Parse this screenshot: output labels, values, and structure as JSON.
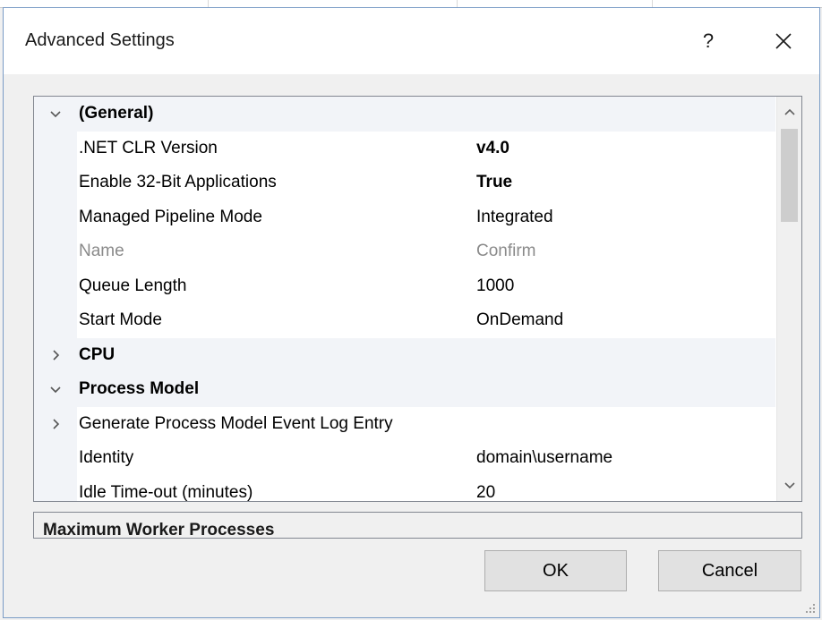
{
  "dialog": {
    "title": "Advanced Settings",
    "help_label": "?",
    "close_icon": "close-icon"
  },
  "property_grid": {
    "rows": [
      {
        "kind": "category",
        "expander": "expanded",
        "name": "(General)"
      },
      {
        "kind": "property",
        "name": ".NET CLR Version",
        "value": "v4.0",
        "bold": true
      },
      {
        "kind": "property",
        "name": "Enable 32-Bit Applications",
        "value": "True",
        "bold": true
      },
      {
        "kind": "property",
        "name": "Managed Pipeline Mode",
        "value": "Integrated"
      },
      {
        "kind": "property",
        "name": "Name",
        "value": "Confirm",
        "disabled": true
      },
      {
        "kind": "property",
        "name": "Queue Length",
        "value": "1000"
      },
      {
        "kind": "property",
        "name": "Start Mode",
        "value": "OnDemand"
      },
      {
        "kind": "category",
        "expander": "collapsed",
        "name": "CPU"
      },
      {
        "kind": "category",
        "expander": "expanded",
        "name": "Process Model"
      },
      {
        "kind": "property",
        "expander": "collapsed",
        "name": "Generate Process Model Event Log Entry",
        "value": ""
      },
      {
        "kind": "property",
        "name": "Identity",
        "value": "domain\\username"
      },
      {
        "kind": "property",
        "name": "Idle Time-out (minutes)",
        "value": "20"
      }
    ]
  },
  "description": {
    "title": "Maximum Worker Processes"
  },
  "buttons": {
    "ok_label": "OK",
    "cancel_label": "Cancel"
  },
  "colors": {
    "category_background": "#f2f4f8",
    "disabled_text": "#8a8a8a",
    "dialog_border": "#7a9cc6"
  }
}
